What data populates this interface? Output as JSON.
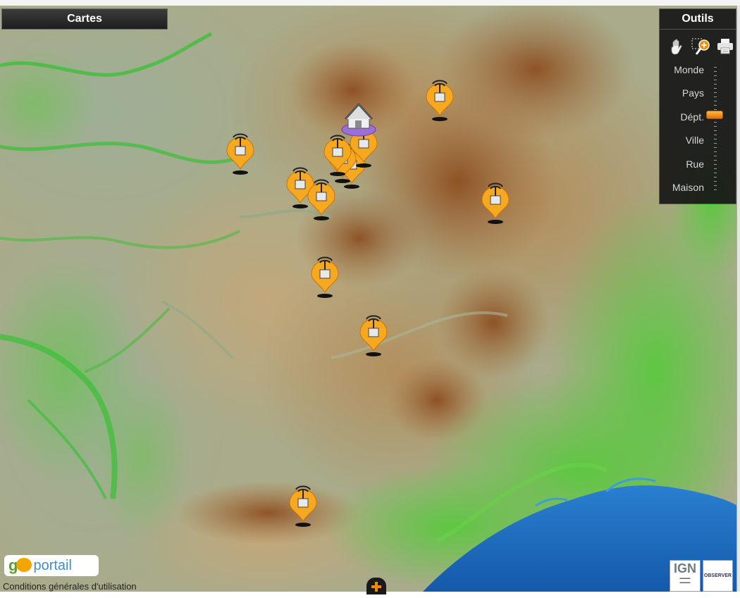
{
  "panels": {
    "cartes_label": "Cartes",
    "outils_label": "Outils"
  },
  "zoom": {
    "levels": [
      "Monde",
      "Pays",
      "Dépt.",
      "Ville",
      "Rue",
      "Maison"
    ],
    "selected": "Dépt."
  },
  "tools": [
    {
      "icon": "hand-pan-icon"
    },
    {
      "icon": "zoom-box-icon"
    },
    {
      "icon": "print-icon"
    }
  ],
  "footer": {
    "conditions": "Conditions générales d'utilisation",
    "logo_geo_left": "g",
    "logo_geo_right": "",
    "logo_portail": "portail",
    "ign": "IGN",
    "observer": "OBSERVER"
  },
  "markers": {
    "antenna_count": 14,
    "house_count": 1
  },
  "colors": {
    "marker_orange": "#f7a821",
    "house_purple": "#9b6fd6",
    "panel_bg": "#1a1a1a",
    "zoom_handle": "#f08a00",
    "sea_blue": "#1a6fc4",
    "lowland_green": "#4fbf3a"
  }
}
